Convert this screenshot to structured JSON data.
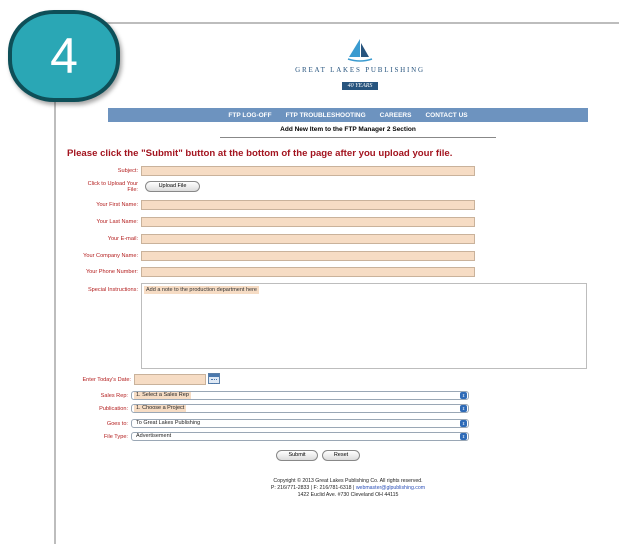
{
  "step_badge": "4",
  "logo": {
    "text": "GREAT LAKES PUBLISHING",
    "ribbon": "40 YEARS"
  },
  "nav": [
    "FTP LOG-OFF",
    "FTP TROUBLESHOOTING",
    "CAREERS",
    "CONTACT US"
  ],
  "section_heading": "Add New Item to the FTP Manager 2 Section",
  "instruction": "Please click the \"Submit\" button at the bottom of the page after you upload your file.",
  "form": {
    "subject_label": "Subject:",
    "upload_label_1": "Click to Upload Your",
    "upload_label_2": "File:",
    "upload_button": "Upload File",
    "first_name_label": "Your First Name:",
    "last_name_label": "Your Last Name:",
    "email_label": "Your E-mail:",
    "company_label": "Your Company Name:",
    "phone_label": "Your Phone Number:",
    "special_label": "Special Instructions:",
    "special_placeholder": "Add a note to the production department here",
    "date_label": "Enter Today's Date:",
    "sales_rep_label": "Sales Rep:",
    "sales_rep_value": "1. Select a Sales Rep",
    "publication_label": "Publication:",
    "publication_value": "1. Choose a Project",
    "goes_to_label": "Goes to:",
    "goes_to_value": "To Great Lakes Publishing",
    "file_type_label": "File Type:",
    "file_type_value": "Advertisement",
    "submit_button": "Submit",
    "reset_button": "Reset"
  },
  "footer": {
    "line1": "Copyright © 2013 Great Lakes Publishing Co. All rights reserved.",
    "line2_prefix": "P: 216/771-2833 | F: 216/781-6318 | ",
    "line2_link": "webmaster@glpublishing.com",
    "line3": "1422 Euclid Ave. #730 Cleveland OH 44115"
  }
}
